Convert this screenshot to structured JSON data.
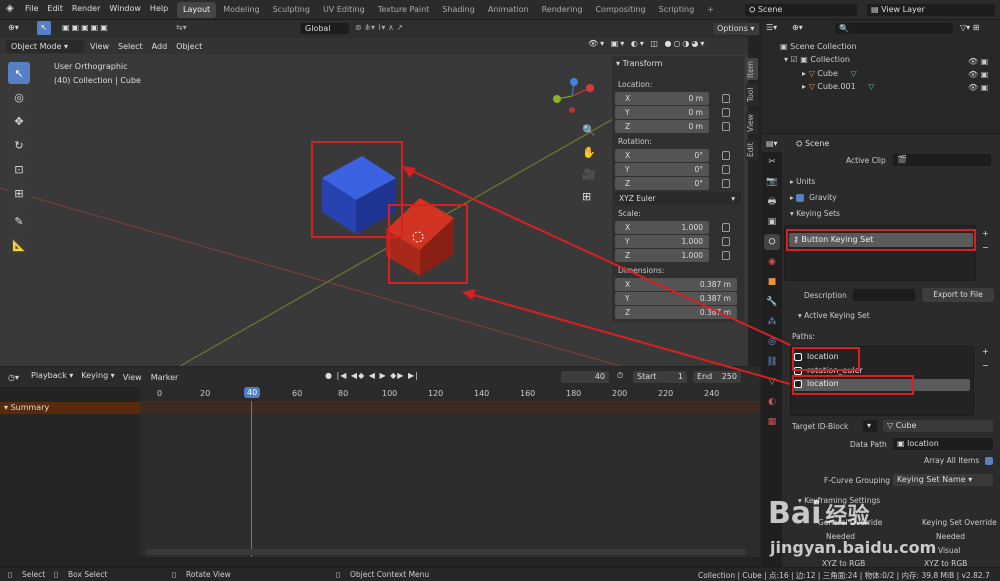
{
  "topbar": {
    "menus": [
      "File",
      "Edit",
      "Render",
      "Window",
      "Help"
    ],
    "workspaces": [
      "Layout",
      "Modeling",
      "Sculpting",
      "UV Editing",
      "Texture Paint",
      "Shading",
      "Animation",
      "Rendering",
      "Compositing",
      "Scripting"
    ],
    "active_workspace": "Layout",
    "add_tab": "+",
    "scene": "Scene",
    "view_layer": "View Layer"
  },
  "viewport": {
    "mode": "Object Mode",
    "menus": [
      "View",
      "Select",
      "Add",
      "Object"
    ],
    "orientation": "Global",
    "options": "Options",
    "view_name": "User Orthographic",
    "context": "(40) Collection | Cube",
    "tabs": [
      "Item",
      "Tool",
      "View",
      "Edit"
    ]
  },
  "transform": {
    "title": "Transform",
    "location_label": "Location:",
    "location": [
      {
        "axis": "X",
        "value": "0 m"
      },
      {
        "axis": "Y",
        "value": "0 m"
      },
      {
        "axis": "Z",
        "value": "0 m"
      }
    ],
    "rotation_label": "Rotation:",
    "rotation": [
      {
        "axis": "X",
        "value": "0°"
      },
      {
        "axis": "Y",
        "value": "0°"
      },
      {
        "axis": "Z",
        "value": "0°"
      }
    ],
    "rotation_mode": "XYZ Euler",
    "scale_label": "Scale:",
    "scale": [
      {
        "axis": "X",
        "value": "1.000"
      },
      {
        "axis": "Y",
        "value": "1.000"
      },
      {
        "axis": "Z",
        "value": "1.000"
      }
    ],
    "dimensions_label": "Dimensions:",
    "dimensions": [
      {
        "axis": "X",
        "value": "0.387 m"
      },
      {
        "axis": "Y",
        "value": "0.387 m"
      },
      {
        "axis": "Z",
        "value": "0.387 m"
      }
    ]
  },
  "timeline": {
    "menus": [
      "Playback",
      "Keying",
      "View",
      "Marker"
    ],
    "current_frame": "40",
    "start_label": "Start",
    "start": "1",
    "end_label": "End",
    "end": "250",
    "ticks": [
      "0",
      "20",
      "40",
      "60",
      "80",
      "100",
      "120",
      "140",
      "160",
      "180",
      "200",
      "220",
      "240"
    ],
    "summary": "Summary"
  },
  "statusbar": {
    "select": "Select",
    "box_select": "Box Select",
    "rotate_view": "Rotate View",
    "context_menu": "Object Context Menu",
    "stats": "Collection | Cube | 点:16 | 边:12 | 三角面:24 | 物体:0/2 | 内存: 39.8 MiB | v2.82.7"
  },
  "outliner": {
    "root": "Scene Collection",
    "collection": "Collection",
    "items": [
      "Cube",
      "Cube.001"
    ]
  },
  "properties": {
    "scene": "Scene",
    "active_clip_label": "Active Clip",
    "units": "Units",
    "gravity": "Gravity",
    "keying_sets": "Keying Sets",
    "keying_set_name": "Button Keying Set",
    "description_label": "Description",
    "export": "Export to File",
    "active_keying_set": "Active Keying Set",
    "paths_label": "Paths:",
    "paths": [
      "location",
      "rotation_euler",
      "location"
    ],
    "target_label": "Target ID-Block",
    "target": "Cube",
    "data_path_label": "Data Path",
    "data_path": "location",
    "array_all": "Array All Items",
    "fcurve_label": "F-Curve Grouping",
    "fcurve": "Keying Set Name",
    "keyframing_settings": "Keyframing Settings",
    "general_override": "General Override",
    "ks_override": "Keying Set Override",
    "needed": "Needed",
    "visual": "Visual",
    "xyz_rgb": "XYZ to RGB"
  },
  "watermark": {
    "text1": "Bai",
    "text2": "经验",
    "url": "jingyan.baidu.com"
  },
  "colors": {
    "accent": "#5680c2",
    "annotation": "#d92020",
    "cube_blue": "#2a4fc0",
    "cube_red": "#b3271b"
  }
}
